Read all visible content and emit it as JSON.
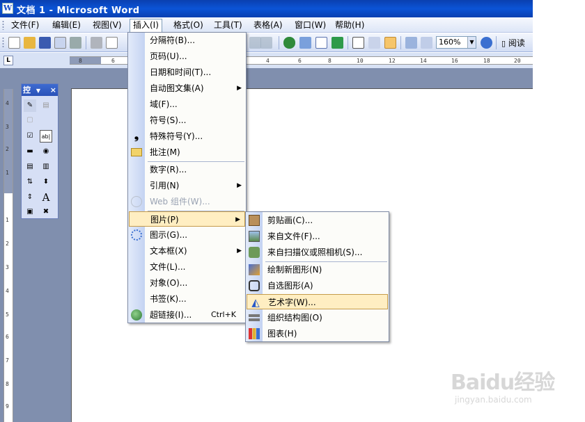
{
  "window": {
    "title": "文档 1 - Microsoft Word",
    "app_icon_glyph": "W"
  },
  "menubar": [
    {
      "label": "文件(F)"
    },
    {
      "label": "编辑(E)"
    },
    {
      "label": "视图(V)"
    },
    {
      "label": "插入(I)",
      "active": true
    },
    {
      "label": "格式(O)"
    },
    {
      "label": "工具(T)"
    },
    {
      "label": "表格(A)"
    },
    {
      "label": "窗口(W)"
    },
    {
      "label": "帮助(H)"
    }
  ],
  "toolbar": {
    "zoom": "160%",
    "read_label": "阅读"
  },
  "ruler": {
    "h_labels": [
      "8",
      "6",
      "4",
      "6",
      "8",
      "10",
      "12",
      "14",
      "16",
      "18",
      "20"
    ],
    "v_labels": [
      "4",
      "3",
      "2",
      "1",
      "1",
      "2",
      "3",
      "4",
      "5",
      "6",
      "7",
      "8",
      "9"
    ]
  },
  "toolbox": {
    "title": "控",
    "glyph_a": "A",
    "glyph_ab": "ab|"
  },
  "insert_menu": {
    "items": [
      {
        "label": "分隔符(B)...",
        "icon": "none"
      },
      {
        "label": "页码(U)...",
        "icon": "none"
      },
      {
        "label": "日期和时间(T)...",
        "icon": "none"
      },
      {
        "label": "自动图文集(A)",
        "icon": "none",
        "submenu": true
      },
      {
        "label": "域(F)...",
        "icon": "none"
      },
      {
        "label": "符号(S)...",
        "icon": "none"
      },
      {
        "label": "特殊符号(Y)...",
        "icon": "comma-icon"
      },
      {
        "label": "批注(M)",
        "icon": "comment-icon"
      },
      {
        "label": "数字(R)...",
        "icon": "none"
      },
      {
        "label": "引用(N)",
        "icon": "none",
        "submenu": true
      },
      {
        "label": "Web 组件(W)...",
        "icon": "web-icon",
        "disabled": true
      },
      {
        "label": "图片(P)",
        "icon": "none",
        "submenu": true,
        "highlighted": true
      },
      {
        "label": "图示(G)...",
        "icon": "diagram-icon"
      },
      {
        "label": "文本框(X)",
        "icon": "none",
        "submenu": true
      },
      {
        "label": "文件(L)...",
        "icon": "none"
      },
      {
        "label": "对象(O)...",
        "icon": "none"
      },
      {
        "label": "书签(K)...",
        "icon": "none"
      },
      {
        "label": "超链接(I)...",
        "icon": "hyperlink-icon",
        "shortcut": "Ctrl+K"
      }
    ]
  },
  "picture_submenu": {
    "items": [
      {
        "label": "剪贴画(C)...",
        "icon": "clipart-icon"
      },
      {
        "label": "来自文件(F)...",
        "icon": "image-file-icon"
      },
      {
        "label": "来自扫描仪或照相机(S)...",
        "icon": "scanner-icon"
      },
      {
        "label": "绘制新图形(N)",
        "icon": "draw-shape-icon"
      },
      {
        "label": "自选图形(A)",
        "icon": "autoshape-icon"
      },
      {
        "label": "艺术字(W)...",
        "icon": "wordart-icon",
        "highlighted": true
      },
      {
        "label": "组织结构图(O)",
        "icon": "org-chart-icon"
      },
      {
        "label": "图表(H)",
        "icon": "chart-icon"
      }
    ]
  },
  "watermark": {
    "logo": "Baidu经验",
    "url": "jingyan.baidu.com"
  }
}
